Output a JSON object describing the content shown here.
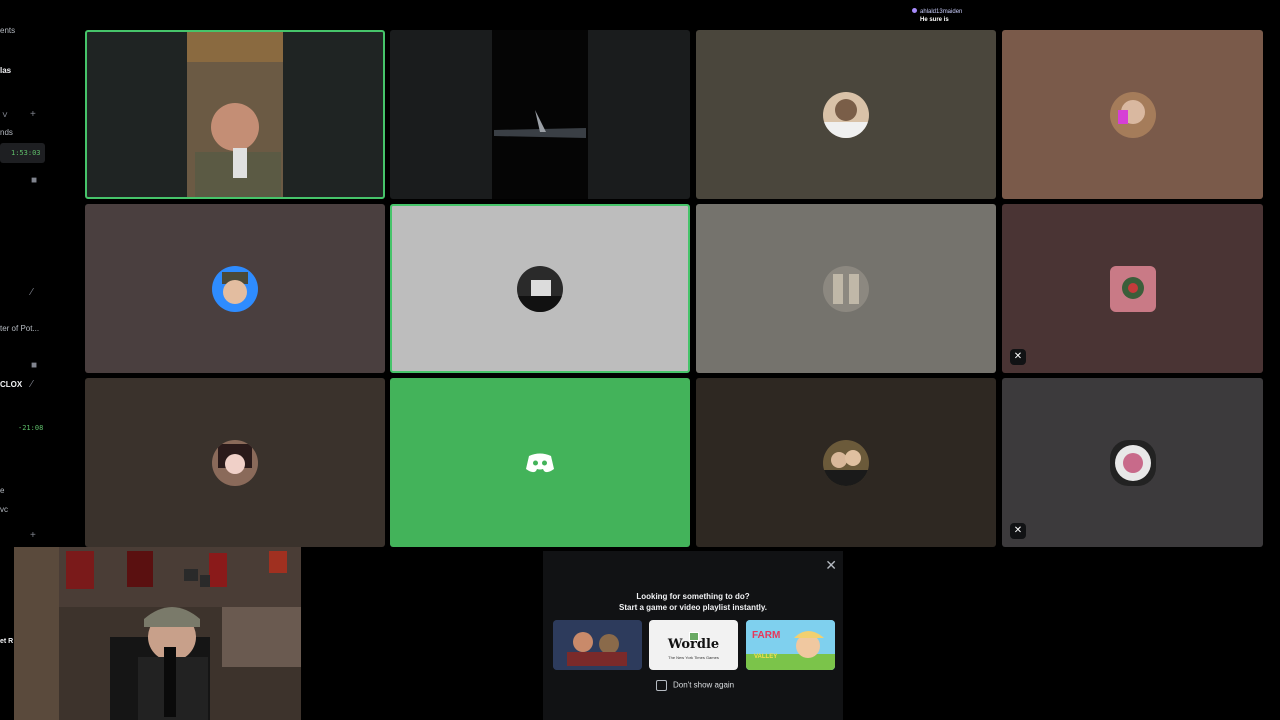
{
  "sidebar": {
    "line_1": "ents",
    "line_2": "las",
    "line_3": "nds",
    "timer_1": "1:53:03",
    "line_4": "ter of Pot...",
    "line_5": "CLOX",
    "timer_2": "-21:08",
    "line_6": "e",
    "line_7": "vc",
    "line_8": "et R"
  },
  "chat_overlay": {
    "username": "ahlald13maiden",
    "message": "He sure is"
  },
  "tiles": [
    {
      "id": "tile-1",
      "kind": "video",
      "bg": "#1f2423",
      "speaking": true
    },
    {
      "id": "tile-2",
      "kind": "video",
      "bg": "#1a1c1d",
      "speaking": false
    },
    {
      "id": "tile-3",
      "kind": "avatar",
      "bg": "#4a463c",
      "speaking": false,
      "muted": false
    },
    {
      "id": "tile-4",
      "kind": "avatar",
      "bg": "#7a5a4a",
      "speaking": false,
      "muted": false
    },
    {
      "id": "tile-5",
      "kind": "avatar",
      "bg": "#4a3f3f",
      "speaking": false,
      "muted": false
    },
    {
      "id": "tile-6",
      "kind": "avatar",
      "bg": "#bdbdbd",
      "speaking": true,
      "muted": false
    },
    {
      "id": "tile-7",
      "kind": "avatar",
      "bg": "#75736d",
      "speaking": false,
      "muted": false
    },
    {
      "id": "tile-8",
      "kind": "avatar",
      "bg": "#4a3434",
      "speaking": false,
      "muted": true
    },
    {
      "id": "tile-9",
      "kind": "avatar",
      "bg": "#3a322c",
      "speaking": false,
      "muted": false
    },
    {
      "id": "tile-10",
      "kind": "discord",
      "bg": "#43b35a",
      "speaking": false,
      "muted": false
    },
    {
      "id": "tile-11",
      "kind": "avatar",
      "bg": "#2e2822",
      "speaking": false,
      "muted": false
    },
    {
      "id": "tile-12",
      "kind": "avatar",
      "bg": "#3c3a3c",
      "speaking": false,
      "muted": true
    }
  ],
  "activity_prompt": {
    "heading_line_1": "Looking for something to do?",
    "heading_line_2": "Start a game or video playlist instantly.",
    "close_icon": "close-icon",
    "cards": [
      {
        "name": "game-card-1",
        "label": ""
      },
      {
        "name": "game-card-wordle",
        "label": "Wordle",
        "sublabel": "The New York Times Games"
      },
      {
        "name": "game-card-farm",
        "label": "FARM",
        "sublabel": "VALLEY"
      }
    ],
    "checkbox_label": "Don't show again"
  },
  "colors": {
    "speaking_border": "#46c46a",
    "discord_green": "#43b35a",
    "background": "#000000"
  }
}
